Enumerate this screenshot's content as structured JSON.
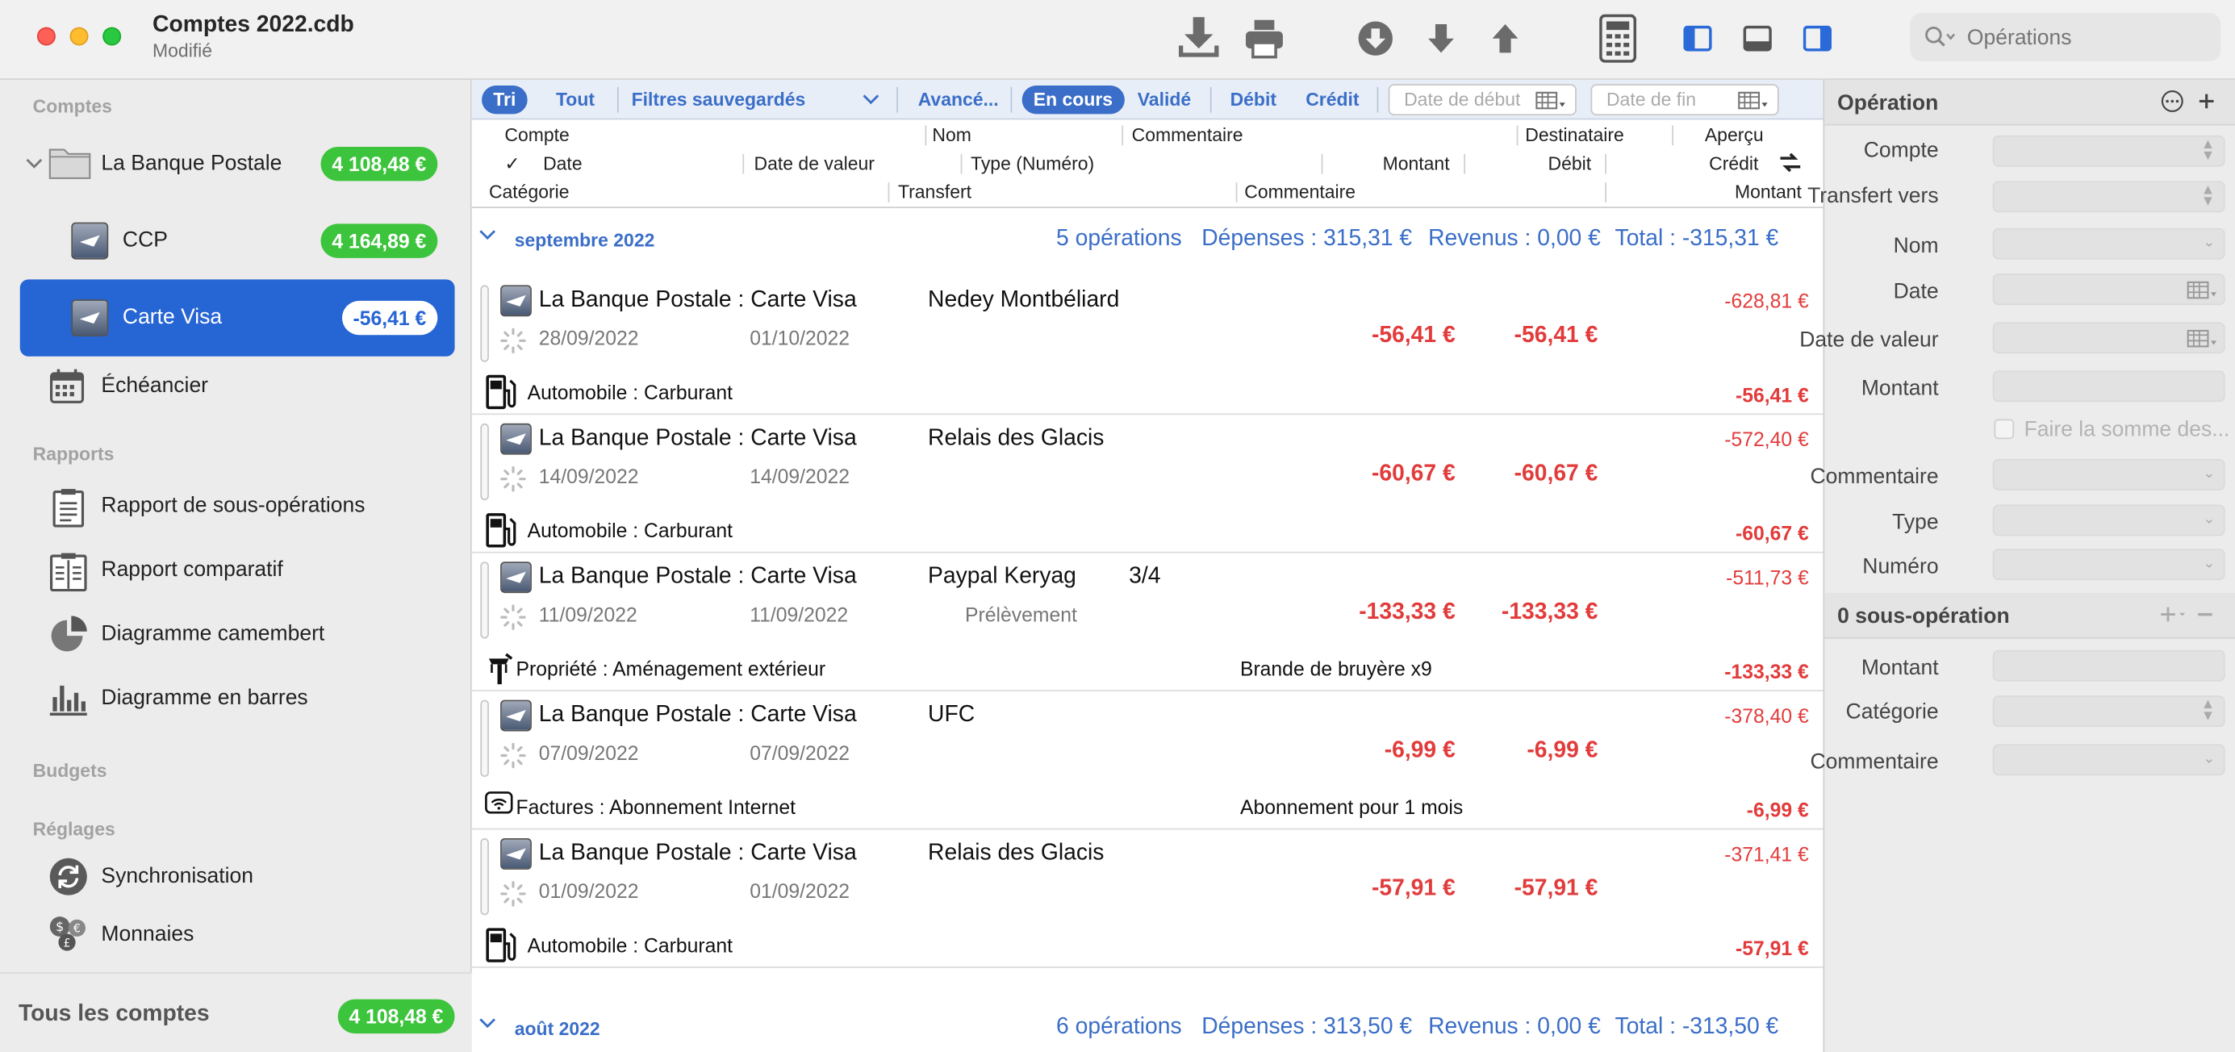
{
  "window": {
    "title": "Comptes 2022.cdb",
    "status": "Modifié"
  },
  "toolbar": {
    "search_placeholder": "Opérations"
  },
  "sidebar": {
    "sections": {
      "accounts": "Comptes",
      "reports": "Rapports",
      "budgets": "Budgets",
      "settings": "Réglages"
    },
    "bank": {
      "label": "La Banque Postale",
      "balance": "4 108,48 €"
    },
    "accounts": [
      {
        "label": "CCP",
        "balance": "4 164,89 €"
      },
      {
        "label": "Carte Visa",
        "balance": "-56,41 €"
      }
    ],
    "scheduler": "Échéancier",
    "reports": [
      {
        "label": "Rapport de sous-opérations",
        "icon": "document-icon"
      },
      {
        "label": "Rapport comparatif",
        "icon": "document-compare-icon"
      },
      {
        "label": "Diagramme camembert",
        "icon": "pie-chart-icon"
      },
      {
        "label": "Diagramme en barres",
        "icon": "bar-chart-icon"
      }
    ],
    "settings": [
      {
        "label": "Synchronisation",
        "icon": "sync-icon"
      },
      {
        "label": "Monnaies",
        "icon": "currency-icon"
      }
    ],
    "all_accounts": {
      "label": "Tous les comptes",
      "balance": "4 108,48 €"
    }
  },
  "filters": {
    "sort": "Tri",
    "all": "Tout",
    "saved": "Filtres sauvegardés",
    "advanced": "Avancé...",
    "in_progress": "En cours",
    "validated": "Validé",
    "debit": "Débit",
    "credit": "Crédit",
    "start_date": "Date de début",
    "end_date": "Date de fin"
  },
  "columns": {
    "row1": {
      "account": "Compte",
      "name": "Nom",
      "comment": "Commentaire",
      "recipient": "Destinataire",
      "preview": "Aperçu"
    },
    "row2": {
      "check": "✓",
      "date": "Date",
      "value_date": "Date de valeur",
      "type": "Type (Numéro)",
      "amount": "Montant",
      "debit": "Débit",
      "credit": "Crédit"
    },
    "row3": {
      "category": "Catégorie",
      "transfer": "Transfert",
      "comment": "Commentaire",
      "amount": "Montant"
    }
  },
  "months": [
    {
      "name": "septembre 2022",
      "count": "5 opérations",
      "expenses": "Dépenses : 315,31 €",
      "income": "Revenus : 0,00 €",
      "total": "Total : -315,31 €"
    },
    {
      "name": "août 2022",
      "count": "6 opérations",
      "expenses": "Dépenses : 313,50 €",
      "income": "Revenus : 0,00 €",
      "total": "Total : -313,50 €"
    }
  ],
  "operations": [
    {
      "account": "La Banque Postale : Carte Visa",
      "name": "Nedey Montbéliard",
      "number": "",
      "date": "28/09/2022",
      "value_date": "01/10/2022",
      "type": "",
      "amount": "-56,41 €",
      "debit": "-56,41 €",
      "balance": "-628,81 €",
      "category": "Automobile : Carburant",
      "cat_icon": "fuel-pump-icon",
      "comment": "",
      "split_amount": "-56,41 €"
    },
    {
      "account": "La Banque Postale : Carte Visa",
      "name": "Relais des Glacis",
      "number": "",
      "date": "14/09/2022",
      "value_date": "14/09/2022",
      "type": "",
      "amount": "-60,67 €",
      "debit": "-60,67 €",
      "balance": "-572,40 €",
      "category": "Automobile : Carburant",
      "cat_icon": "fuel-pump-icon",
      "comment": "",
      "split_amount": "-60,67 €"
    },
    {
      "account": "La Banque Postale : Carte Visa",
      "name": "Paypal Keryag",
      "number": "3/4",
      "date": "11/09/2022",
      "value_date": "11/09/2022",
      "type": "Prélèvement",
      "amount": "-133,33 €",
      "debit": "-133,33 €",
      "balance": "-511,73 €",
      "category": "Propriété : Aménagement extérieur",
      "cat_icon": "tools-icon",
      "comment": "Brande de bruyère x9",
      "split_amount": "-133,33 €"
    },
    {
      "account": "La Banque Postale : Carte Visa",
      "name": "UFC",
      "number": "",
      "date": "07/09/2022",
      "value_date": "07/09/2022",
      "type": "",
      "amount": "-6,99 €",
      "debit": "-6,99 €",
      "balance": "-378,40 €",
      "category": "Factures : Abonnement Internet",
      "cat_icon": "wifi-icon",
      "comment": "Abonnement  pour 1 mois",
      "split_amount": "-6,99 €"
    },
    {
      "account": "La Banque Postale : Carte Visa",
      "name": "Relais des Glacis",
      "number": "",
      "date": "01/09/2022",
      "value_date": "01/09/2022",
      "type": "",
      "amount": "-57,91 €",
      "debit": "-57,91 €",
      "balance": "-371,41 €",
      "category": "Automobile : Carburant",
      "cat_icon": "fuel-pump-icon",
      "comment": "",
      "split_amount": "-57,91 €"
    }
  ],
  "inspector": {
    "title": "Opération",
    "fields": [
      "Compte",
      "Transfert vers",
      "Nom",
      "Date",
      "Date de valeur",
      "Montant"
    ],
    "sum_label": "Faire la somme des...",
    "fields2": [
      "Commentaire",
      "Type",
      "Numéro"
    ],
    "split_title": "0 sous-opération",
    "split_fields": [
      "Montant",
      "Catégorie",
      "Commentaire"
    ]
  },
  "colors": {
    "accent": "#3a6ec8",
    "selected": "#2665d4",
    "positive_badge": "#3dc43d",
    "negative": "#e23b3b"
  }
}
